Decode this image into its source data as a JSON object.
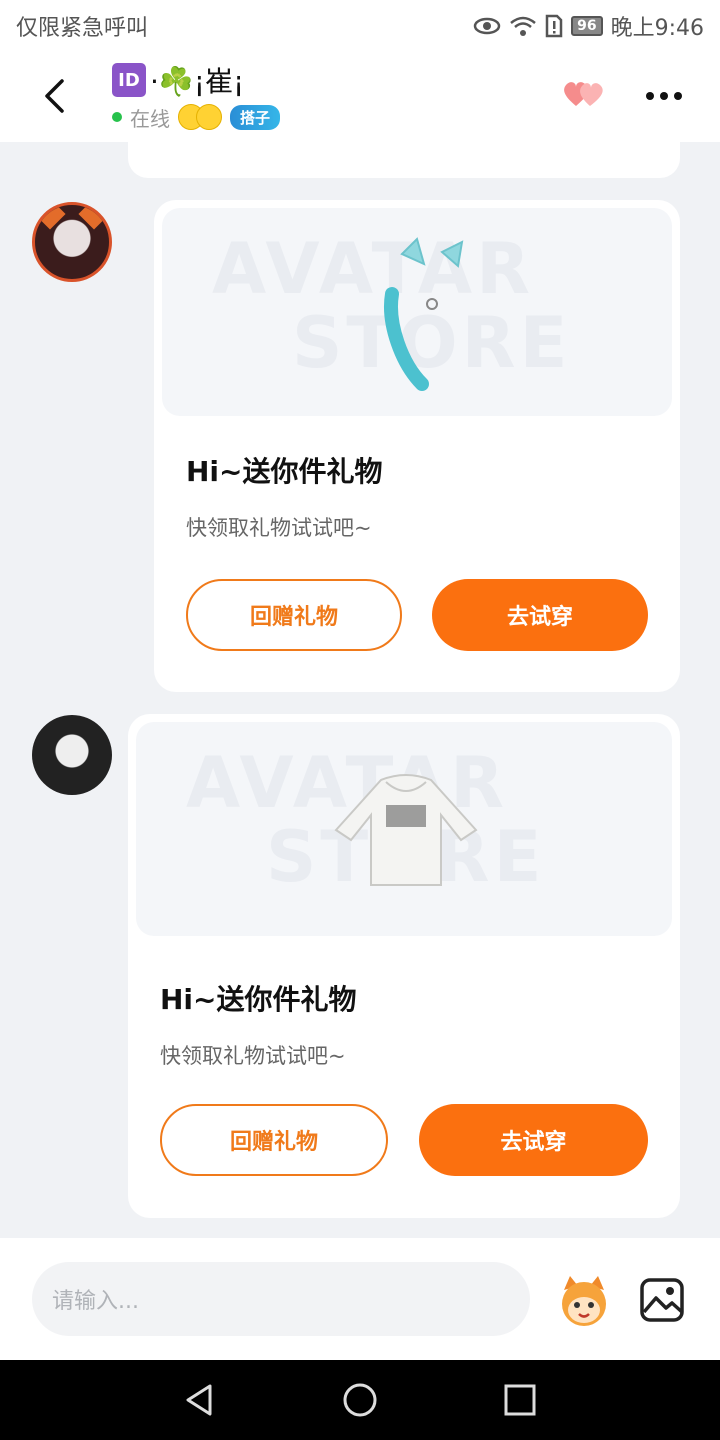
{
  "status_bar": {
    "carrier_text": "仅限紧急呼叫",
    "battery": "96",
    "time": "晚上9:46"
  },
  "header": {
    "id_badge": "ID",
    "title": "·☘️¡崔¡",
    "status": "在线",
    "tag": "搭子"
  },
  "messages": [
    {
      "title": "Hi~送你件礼物",
      "subtitle": "快领取礼物试试吧~",
      "watermark_top": "AVATAR",
      "watermark_bottom": "STORE",
      "item": "cat-ears-headband",
      "secondary_button": "回赠礼物",
      "primary_button": "去试穿"
    },
    {
      "title": "Hi~送你件礼物",
      "subtitle": "快领取礼物试试吧~",
      "watermark_top": "AVATAR",
      "watermark_bottom": "STORE",
      "item": "white-hoodie",
      "secondary_button": "回赠礼物",
      "primary_button": "去试穿"
    }
  ],
  "input_bar": {
    "placeholder": "请输入..."
  },
  "colors": {
    "accent": "#fb700f",
    "background": "#f0f2f5",
    "online": "#27c24c"
  }
}
